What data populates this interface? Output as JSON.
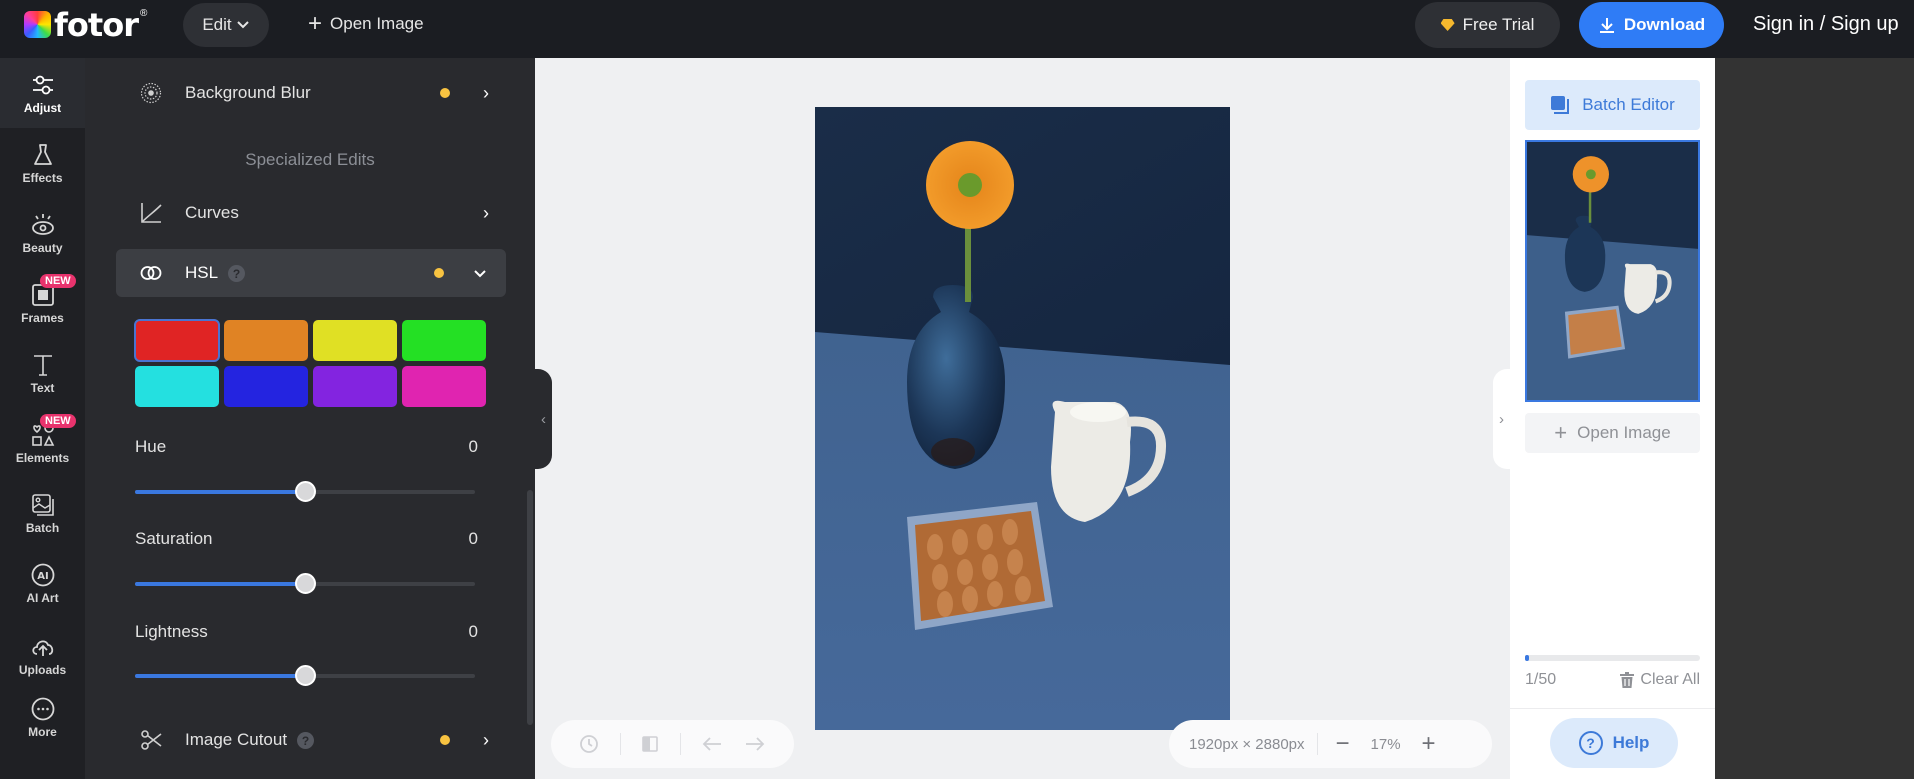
{
  "topbar": {
    "logo_text": "fotor",
    "logo_reg": "®",
    "edit_label": "Edit",
    "open_image_label": "Open Image",
    "free_trial_label": "Free Trial",
    "download_label": "Download",
    "signin_label": "Sign in / Sign up"
  },
  "sidebar": {
    "items": [
      {
        "label": "Adjust",
        "icon": "sliders-icon",
        "active": true
      },
      {
        "label": "Effects",
        "icon": "flask-icon"
      },
      {
        "label": "Beauty",
        "icon": "eye-icon"
      },
      {
        "label": "Frames",
        "icon": "frame-icon",
        "badge": "NEW"
      },
      {
        "label": "Text",
        "icon": "text-icon"
      },
      {
        "label": "Elements",
        "icon": "shapes-icon",
        "badge": "NEW"
      },
      {
        "label": "Batch",
        "icon": "images-icon"
      },
      {
        "label": "AI Art",
        "icon": "ai-icon"
      },
      {
        "label": "Uploads",
        "icon": "cloud-upload-icon"
      },
      {
        "label": "More",
        "icon": "more-icon"
      }
    ]
  },
  "panel": {
    "background_blur": {
      "label": "Background Blur",
      "premium": true
    },
    "section_title": "Specialized Edits",
    "curves": {
      "label": "Curves"
    },
    "hsl": {
      "label": "HSL",
      "help": "?",
      "premium": true,
      "expanded": true,
      "swatches": [
        {
          "name": "red",
          "color": "#e02424",
          "selected": true
        },
        {
          "name": "orange",
          "color": "#e08324"
        },
        {
          "name": "yellow",
          "color": "#e0e024"
        },
        {
          "name": "green",
          "color": "#24e024"
        },
        {
          "name": "cyan",
          "color": "#24e0e0"
        },
        {
          "name": "blue",
          "color": "#2424e0"
        },
        {
          "name": "purple",
          "color": "#8324e0"
        },
        {
          "name": "magenta",
          "color": "#e024b0"
        }
      ],
      "sliders": [
        {
          "label": "Hue",
          "value": "0",
          "fraction": 0.5
        },
        {
          "label": "Saturation",
          "value": "0",
          "fraction": 0.5
        },
        {
          "label": "Lightness",
          "value": "0",
          "fraction": 0.5
        }
      ]
    },
    "image_cutout": {
      "label": "Image Cutout",
      "help": "?",
      "premium": true
    }
  },
  "canvas": {
    "dimensions": "1920px × 2880px",
    "zoom": "17%",
    "zoom_out": "−",
    "zoom_in": "+"
  },
  "right_panel": {
    "batch_editor_label": "Batch Editor",
    "open_image_label": "Open Image",
    "count": "1/50",
    "progress_fraction": 0.02,
    "clear_all_label": "Clear All",
    "help_label": "Help"
  },
  "colors": {
    "accent": "#2f7cf6",
    "premium_dot": "#f8c341",
    "new_badge": "#e8336d"
  }
}
